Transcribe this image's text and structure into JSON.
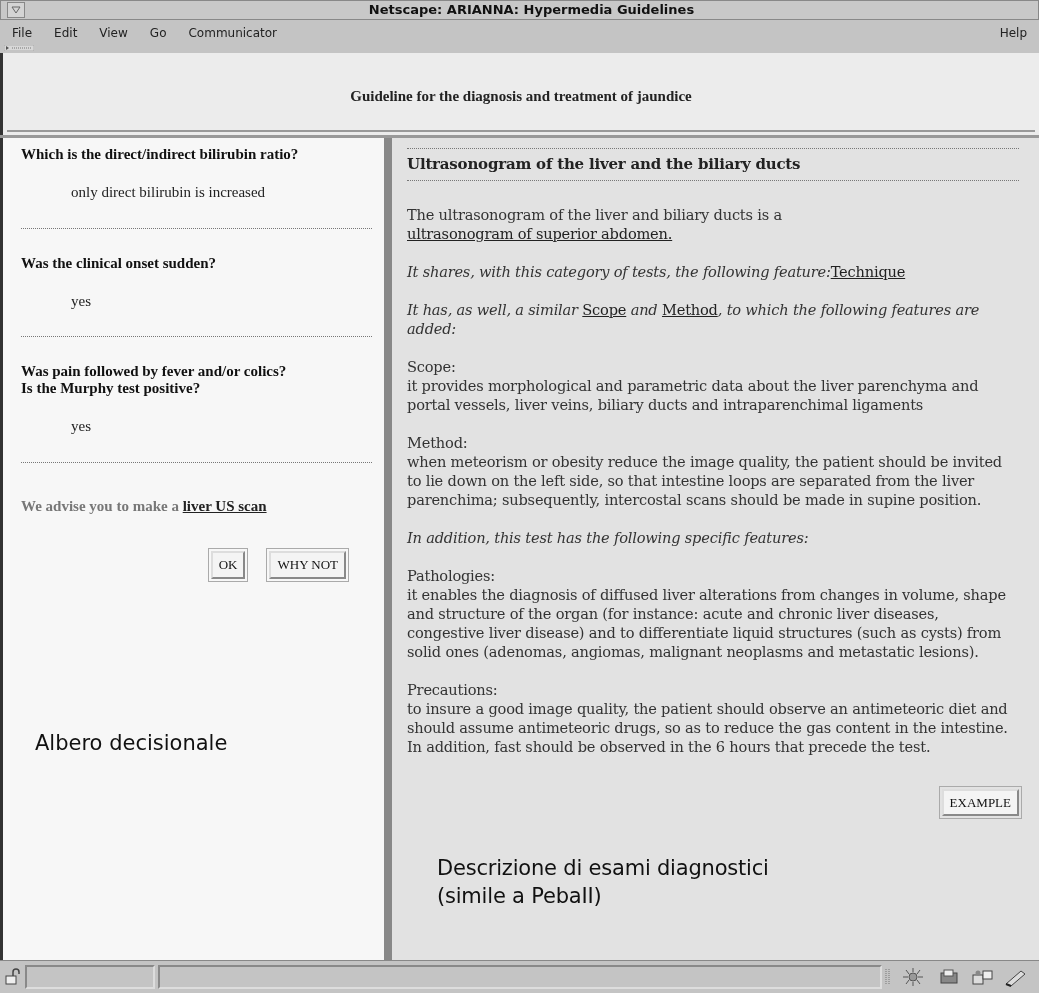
{
  "window": {
    "title": "Netscape: ARIANNA: Hypermedia Guidelines"
  },
  "menu": {
    "items": [
      "File",
      "Edit",
      "View",
      "Go",
      "Communicator"
    ],
    "help": "Help"
  },
  "header": {
    "title": "Guideline for the diagnosis and treatment of jaundice"
  },
  "decision_tree": {
    "questions": [
      {
        "question": [
          "Which is the direct/indirect bilirubin ratio?"
        ],
        "answer": "only direct bilirubin is increased"
      },
      {
        "question": [
          "Was the clinical onset sudden?"
        ],
        "answer": "yes"
      },
      {
        "question": [
          "Was pain followed by fever and/or colics?",
          "Is the Murphy test positive?"
        ],
        "answer": "yes"
      }
    ],
    "advice": {
      "text": "We advise you to make a",
      "link": "liver US scan"
    },
    "buttons": [
      "OK",
      "WHY NOT"
    ],
    "annotation": "Albero decisionale"
  },
  "description": {
    "title": "Ultrasonogram of the liver and the biliary ducts",
    "paragraphs": [
      {
        "kind": "plain",
        "segments": [
          {
            "text": "The ultrasonogram of the liver and biliary ducts is a ",
            "link": false
          },
          {
            "text": "ultrasonogram of superior abdomen.",
            "link": true
          }
        ]
      },
      {
        "kind": "italic",
        "segments": [
          {
            "text": "It shares, with this category of tests, the following feature:",
            "link": false
          },
          {
            "text": "Technique",
            "link": true
          }
        ]
      },
      {
        "kind": "italic",
        "segments": [
          {
            "text": "It has, as well, a similar ",
            "link": false
          },
          {
            "text": "Scope",
            "link": true
          },
          {
            "text": " and ",
            "link": false
          },
          {
            "text": "Method",
            "link": true
          },
          {
            "text": ", to which the following features are added:",
            "link": false
          }
        ]
      },
      {
        "kind": "section",
        "heading": "Scope:",
        "body": "it provides morphological and parametric data about the liver parenchyma and portal vessels, liver veins, biliary ducts and intraparenchimal ligaments"
      },
      {
        "kind": "section",
        "heading": "Method:",
        "body": "when meteorism or obesity reduce the image quality, the patient should be invited to lie down on the left side, so that intestine loops are separated from the liver parenchima; subsequently, intercostal scans should be made in supine position."
      },
      {
        "kind": "italic",
        "segments": [
          {
            "text": "In addition, this test has the following specific features:",
            "link": false
          }
        ]
      },
      {
        "kind": "section",
        "heading": "Pathologies:",
        "body": "it enables the diagnosis of diffused liver alterations from changes in volume, shape and structure of the organ (for instance: acute and chronic liver diseases, congestive liver disease) and to differentiate liquid structures (such as cysts) from solid ones (adenomas, angiomas, malignant neoplasms and metastatic lesions)."
      },
      {
        "kind": "section",
        "heading": "Precautions:",
        "body": "to insure a good image quality, the patient should observe an antimeteoric diet and should assume antimeteoric drugs, so as to reduce the gas content in the intestine. In addition, fast should be observed in the 6 hours that precede the test."
      }
    ],
    "button": "EXAMPLE",
    "annotation": [
      "Descrizione di esami diagnostici",
      "(simile a PebaII)"
    ]
  }
}
